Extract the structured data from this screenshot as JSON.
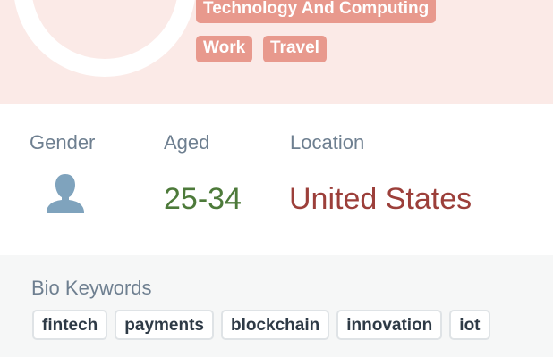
{
  "profile": {
    "categories": [
      "Technology And Computing",
      "Work",
      "Travel"
    ]
  },
  "demographics": {
    "gender_label": "Gender",
    "gender_icon": "person-icon",
    "age_label": "Aged",
    "age_value": "25-34",
    "location_label": "Location",
    "location_value": "United States"
  },
  "bio": {
    "title": "Bio Keywords",
    "keywords": [
      "fintech",
      "payments",
      "blockchain",
      "innovation",
      "iot"
    ]
  },
  "colors": {
    "header_bg": "#fbeae7",
    "tag_bg": "#e8998d",
    "age_color": "#4d7a3a",
    "location_color": "#9c3f3a",
    "icon_color": "#7fa3bd"
  }
}
